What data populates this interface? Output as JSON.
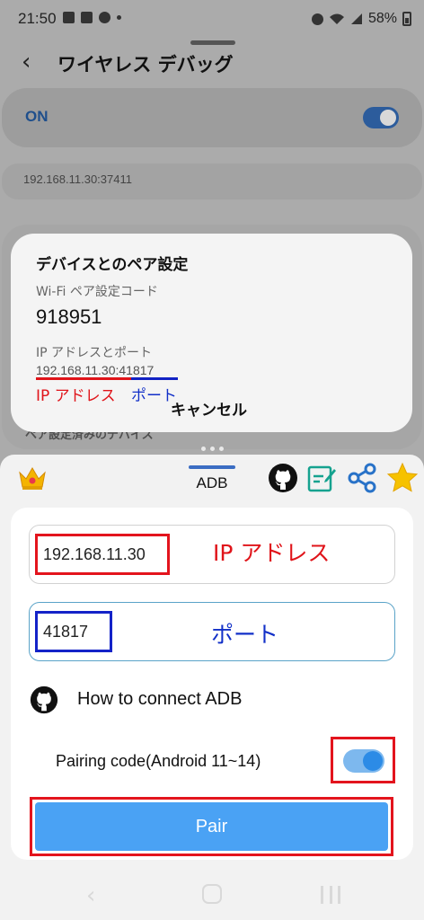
{
  "status_bar": {
    "time": "21:50",
    "battery": "58%"
  },
  "header": {
    "title": "ワイヤレス デバッグ"
  },
  "debug_toggle": {
    "label": "ON",
    "state": true
  },
  "device_address": "192.168.11.30:37411",
  "pairing_dialog": {
    "title": "デバイスとのペア設定",
    "code_label": "Wi-Fi ペア設定コード",
    "code": "918951",
    "ip_port_label": "IP アドレスとポート",
    "ip_value": "192.168.11.30",
    "ip_port_separator": ":",
    "port_value": "41817",
    "annotation_ip": "IP アドレス",
    "annotation_port": "ポート",
    "cancel_label": "キャンセル"
  },
  "paired_devices_label": "ペア設定済みのデバイス",
  "app": {
    "tab_label": "ADB",
    "ip_field_value": "192.168.11.30",
    "ip_annotation": "IP アドレス",
    "port_field_value": "41817",
    "port_annotation": "ポート",
    "howto_label": "How to connect ADB",
    "pairing_label": "Pairing code(Android 11~14)",
    "pairing_toggle_on": true,
    "pair_button_label": "Pair"
  },
  "colors": {
    "annotation_red": "#e0141a",
    "annotation_blue": "#1230c8",
    "pair_button": "#4aa2f4",
    "toggle_on": "#2c8be6"
  }
}
